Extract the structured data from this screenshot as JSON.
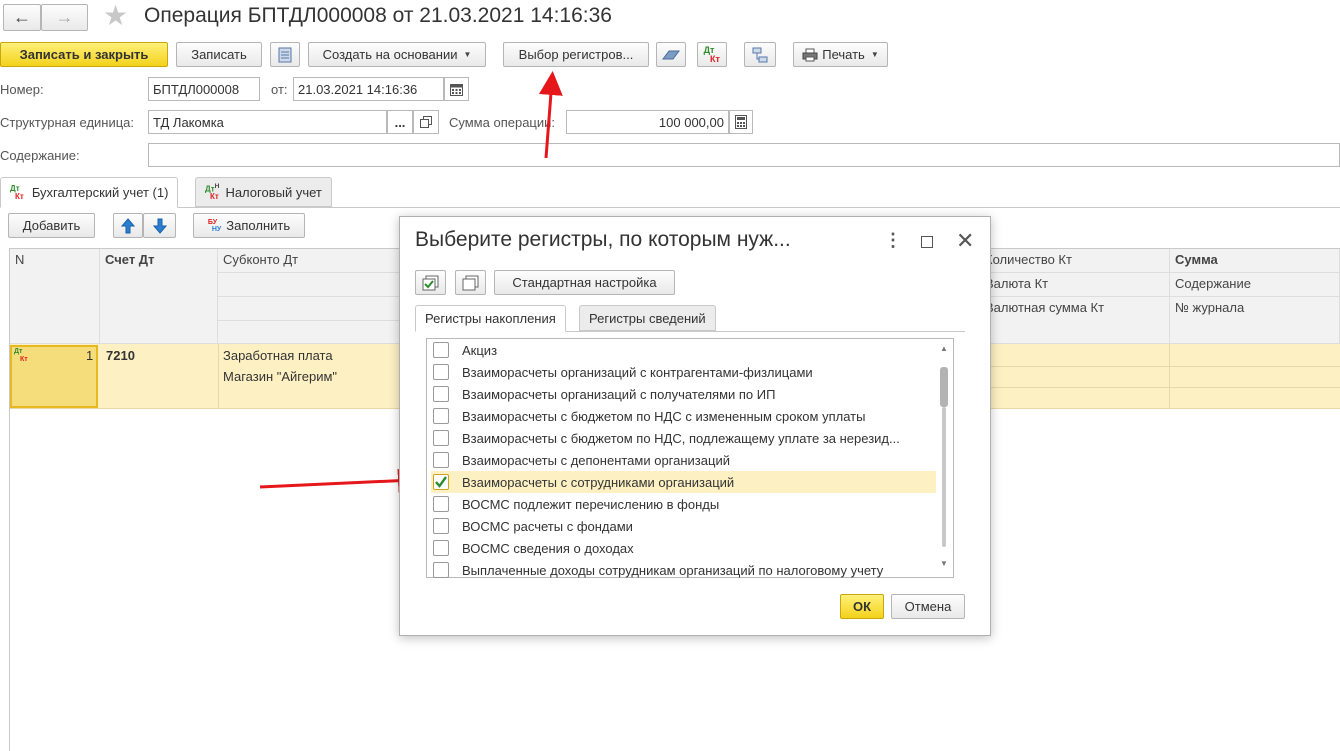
{
  "window": {
    "title": "Операция БПТДЛ000008 от 21.03.2021 14:16:36"
  },
  "toolbar": {
    "save_close": "Записать и закрыть",
    "save": "Записать",
    "create_based": "Создать на основании",
    "select_registers": "Выбор регистров...",
    "print": "Печать"
  },
  "form": {
    "number_label": "Номер:",
    "number_value": "БПТДЛ000008",
    "date_label": "от:",
    "date_value": "21.03.2021 14:16:36",
    "unit_label": "Структурная единица:",
    "unit_value": "ТД Лакомка",
    "unit_select_btn": "...",
    "amount_label": "Сумма операции:",
    "amount_value": "100 000,00",
    "content_label": "Содержание:",
    "content_value": ""
  },
  "tabs": {
    "accounting": "Бухгалтерский учет (1)",
    "tax": "Налоговый учет"
  },
  "table_toolbar": {
    "add": "Добавить",
    "fill": "Заполнить"
  },
  "table": {
    "headers": {
      "n": "N",
      "account_dt": "Счет Дт",
      "subconto_dt": "Субконто Дт",
      "qty_kt": "Количество Кт",
      "currency_kt": "Валюта Кт",
      "currency_amount_kt": "Валютная сумма Кт",
      "sum": "Сумма",
      "content": "Содержание",
      "journal": "№ журнала"
    },
    "row": {
      "n": "1",
      "account_dt": "7210",
      "subconto_1": "Заработная плата",
      "subconto_2": "Магазин \"Айгерим\""
    }
  },
  "dialog": {
    "title": "Выберите регистры, по которым нуж...",
    "standard_settings": "Стандартная настройка",
    "tab_accumulation": "Регистры накопления",
    "tab_info": "Регистры сведений",
    "items": [
      {
        "label": "Акциз",
        "checked": false
      },
      {
        "label": "Взаиморасчеты организаций с контрагентами-физлицами",
        "checked": false
      },
      {
        "label": "Взаиморасчеты организаций с получателями по ИП",
        "checked": false
      },
      {
        "label": "Взаиморасчеты с бюджетом по НДС с измененным сроком уплаты",
        "checked": false
      },
      {
        "label": "Взаиморасчеты с бюджетом по НДС, подлежащему уплате за нерезид...",
        "checked": false
      },
      {
        "label": "Взаиморасчеты с депонентами организаций",
        "checked": false
      },
      {
        "label": "Взаиморасчеты с сотрудниками организаций",
        "checked": true
      },
      {
        "label": "ВОСМС подлежит перечислению в фонды",
        "checked": false
      },
      {
        "label": "ВОСМС расчеты с фондами",
        "checked": false
      },
      {
        "label": "ВОСМС сведения о доходах",
        "checked": false
      },
      {
        "label": "Выплаченные доходы сотрудникам организаций по налоговому учету",
        "checked": false
      }
    ],
    "ok": "ОК",
    "cancel": "Отмена"
  },
  "colors": {
    "accent_yellow": "#f3d21b",
    "selected_row": "#fdf1c4",
    "arrow_red": "#e5171b",
    "check_green": "#2e8b2e"
  }
}
